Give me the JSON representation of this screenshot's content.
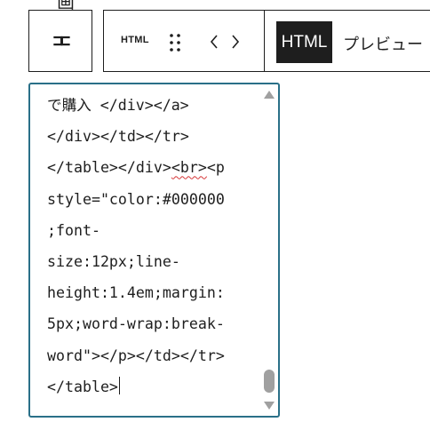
{
  "background_text": "画　　　　　　　　　　　　 ",
  "toolbar": {
    "transform_button_glyph": "⊐⊏",
    "block_type_label": "HTML",
    "drag_handle_icon": "drag-handle-icon",
    "move_left_icon": "chevron-left-icon",
    "move_right_icon": "chevron-right-icon",
    "tabs": [
      {
        "label": "HTML",
        "selected": true
      },
      {
        "label": "プレビュー",
        "selected": false
      }
    ]
  },
  "editor": {
    "lines": [
      "で購入 </div></a>",
      "</div></td></tr>",
      "</table></div>",
      "<br>",
      "<p",
      "style=\"color:#000000",
      ";font-",
      "size:12px;line-",
      "height:1.4em;margin:",
      "5px;word-wrap:break-",
      "word\"></p></td></tr>",
      "</table>"
    ],
    "spellcheck_flagged_word": "br",
    "scroll_position_fraction": 0.96
  },
  "colors": {
    "editor_border": "#2a7088",
    "selected_tab_bg": "#1e1e1e",
    "selected_tab_text": "#ffffff",
    "text": "#1e1e1e",
    "scroll_thumb": "#a0a0a0",
    "spellcheck_underline": "#d63638"
  }
}
